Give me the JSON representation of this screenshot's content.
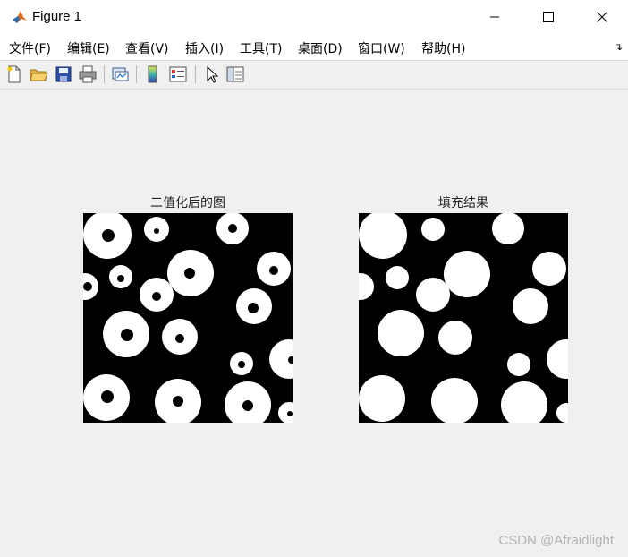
{
  "window": {
    "title": "Figure 1"
  },
  "menu": {
    "items": [
      "文件(F)",
      "编辑(E)",
      "查看(V)",
      "插入(I)",
      "工具(T)",
      "桌面(D)",
      "窗口(W)",
      "帮助(H)"
    ]
  },
  "toolbar": {
    "buttons": [
      "new-figure-icon",
      "open-file-icon",
      "save-icon",
      "print-icon",
      "link-plot-icon",
      "colorbar-icon",
      "legend-icon",
      "pointer-icon",
      "property-inspector-icon"
    ]
  },
  "axes": [
    {
      "title": "二值化后的图",
      "image": "binary-image"
    },
    {
      "title": "填充结果",
      "image": "filled-image"
    }
  ],
  "watermark": "CSDN @Afraidlight",
  "colors": {
    "background": "#f0f0f0",
    "image_bg": "#000000",
    "blob": "#ffffff"
  }
}
